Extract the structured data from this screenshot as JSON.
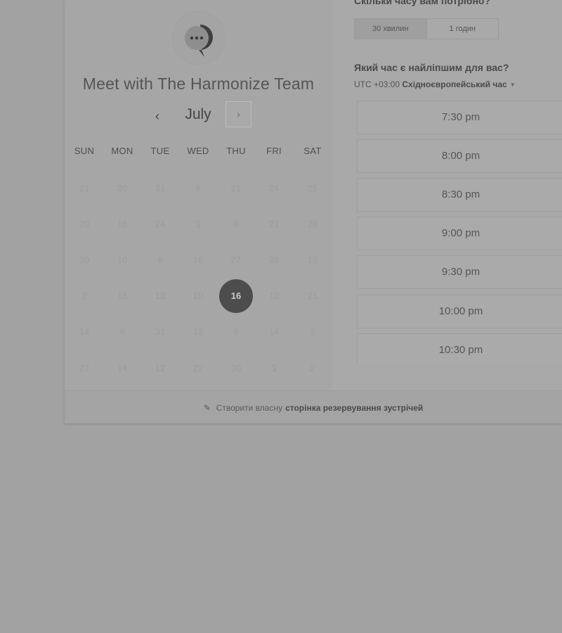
{
  "team": {
    "title": "Meet with The Harmonize Team"
  },
  "calendar": {
    "month": "July",
    "prev_label": "‹",
    "next_label": "›",
    "weekdays": [
      "SUN",
      "MON",
      "TUE",
      "WED",
      "THU",
      "FRI",
      "SAT"
    ],
    "weeks": [
      [
        "21",
        "20",
        "31",
        "8",
        "21",
        "24",
        "25"
      ],
      [
        "20",
        "18",
        "24",
        "3",
        "9",
        "21",
        "26"
      ],
      [
        "30",
        "10",
        "8",
        "16",
        "27",
        "20",
        "15"
      ],
      [
        "2",
        "18",
        "13",
        "10",
        "16",
        "12",
        "21"
      ],
      [
        "14",
        "8",
        "31",
        "13",
        "9",
        "14",
        "2"
      ],
      [
        "27",
        "14",
        "12",
        "22",
        "30",
        "3",
        "2"
      ]
    ],
    "selected": "16"
  },
  "duration": {
    "question": "Скільки часу вам потрібно?",
    "options": [
      "30 хвилин",
      "1 годин"
    ],
    "selected_index": 0
  },
  "time": {
    "question": "Який час є найліпшим для вас?",
    "timezone_prefix": "UTC +03:00",
    "timezone_name": "Східноєвропейський час",
    "slots": [
      "7:30 pm",
      "8:00 pm",
      "8:30 pm",
      "9:00 pm",
      "9:30 pm",
      "10:00 pm",
      "10:30 pm"
    ]
  },
  "footer": {
    "prefix": "Створити власну",
    "link": "сторінка резервування зустрічей"
  },
  "colors": {
    "overlay_bg": "#a2a2a2",
    "selected_day": "#4d4d4d"
  },
  "icons": {
    "avatar": "chat-bubble-icon",
    "footer": "sparkle-icon",
    "timezone": "caret-down-icon"
  }
}
